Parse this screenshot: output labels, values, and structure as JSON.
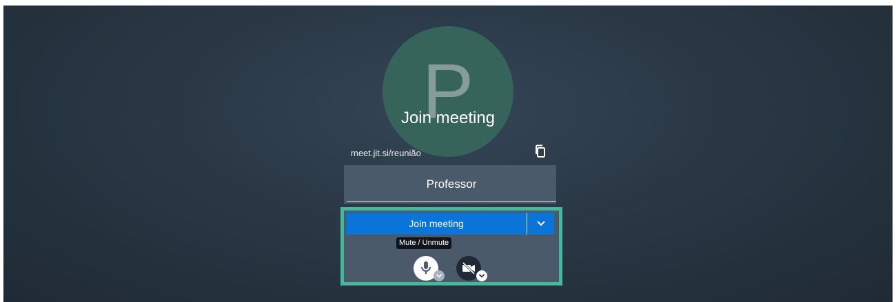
{
  "prejoin": {
    "avatar_initial": "P",
    "title": "Join meeting",
    "meeting_url": "meet.jit.si/reunião",
    "name_input_value": "Professor",
    "join_button_label": "Join meeting",
    "tooltip": "Mute / Unmute"
  },
  "icons": {
    "copy": "copy-icon",
    "dropdown": "chevron-down-icon",
    "mic": "microphone-icon",
    "camera": "video-off-icon",
    "settings_chevron": "chevron-down-icon"
  },
  "colors": {
    "primary": "#0a74d8",
    "highlight": "#44b99c",
    "avatar": "#36635a",
    "panel": "#4a5a6b"
  }
}
